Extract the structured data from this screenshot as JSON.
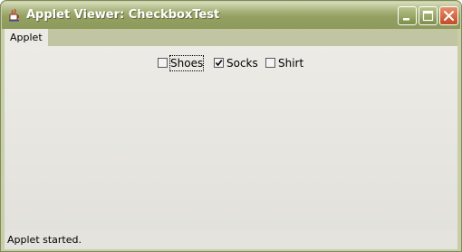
{
  "window": {
    "title": "Applet Viewer: CheckboxTest",
    "icon": "java-cup-icon",
    "controls": [
      "minimize-icon",
      "maximize-icon",
      "close-icon"
    ]
  },
  "menubar": {
    "items": [
      {
        "label": "Applet"
      }
    ]
  },
  "checkboxes": [
    {
      "label": "Shoes",
      "checked": false,
      "focused": true
    },
    {
      "label": "Socks",
      "checked": true,
      "focused": false
    },
    {
      "label": "Shirt",
      "checked": false,
      "focused": false
    }
  ],
  "status": {
    "text": "Applet started."
  }
}
